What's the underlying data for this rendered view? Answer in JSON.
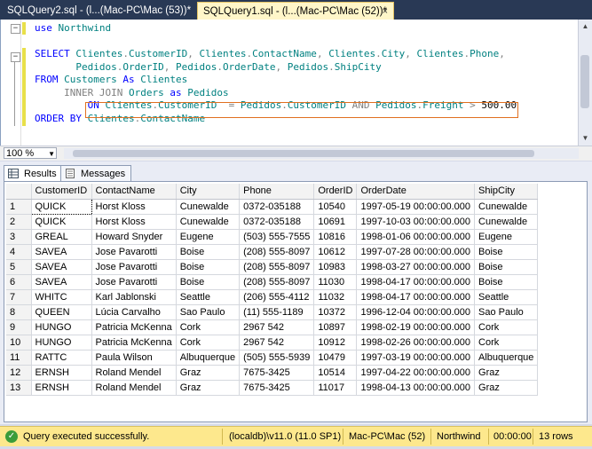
{
  "tabs": [
    {
      "label": "SQLQuery2.sql - (l...(Mac-PC\\Mac (53))*"
    },
    {
      "label": "SQLQuery1.sql - (l...(Mac-PC\\Mac (52))*",
      "close": "×"
    }
  ],
  "editor": {
    "lines": [
      [
        [
          "kw",
          "use"
        ],
        [
          "t",
          " "
        ],
        [
          "id",
          "Northwind"
        ]
      ],
      [
        [
          "t",
          ""
        ]
      ],
      [
        [
          "kw",
          "SELECT"
        ],
        [
          "t",
          " "
        ],
        [
          "id",
          "Clientes"
        ],
        [
          "gr",
          "."
        ],
        [
          "id",
          "CustomerID"
        ],
        [
          "gr",
          ", "
        ],
        [
          "id",
          "Clientes"
        ],
        [
          "gr",
          "."
        ],
        [
          "id",
          "ContactName"
        ],
        [
          "gr",
          ", "
        ],
        [
          "id",
          "Clientes"
        ],
        [
          "gr",
          "."
        ],
        [
          "id",
          "City"
        ],
        [
          "gr",
          ", "
        ],
        [
          "id",
          "Clientes"
        ],
        [
          "gr",
          "."
        ],
        [
          "id",
          "Phone"
        ],
        [
          "gr",
          ","
        ]
      ],
      [
        [
          "t",
          "       "
        ],
        [
          "id",
          "Pedidos"
        ],
        [
          "gr",
          "."
        ],
        [
          "id",
          "OrderID"
        ],
        [
          "gr",
          ", "
        ],
        [
          "id",
          "Pedidos"
        ],
        [
          "gr",
          "."
        ],
        [
          "id",
          "OrderDate"
        ],
        [
          "gr",
          ", "
        ],
        [
          "id",
          "Pedidos"
        ],
        [
          "gr",
          "."
        ],
        [
          "id",
          "ShipCity"
        ]
      ],
      [
        [
          "kw",
          "FROM"
        ],
        [
          "t",
          " "
        ],
        [
          "id",
          "Customers"
        ],
        [
          "t",
          " "
        ],
        [
          "kw",
          "As"
        ],
        [
          "t",
          " "
        ],
        [
          "id",
          "Clientes"
        ]
      ],
      [
        [
          "t",
          "     "
        ],
        [
          "gr",
          "INNER JOIN"
        ],
        [
          "t",
          " "
        ],
        [
          "id",
          "Orders"
        ],
        [
          "t",
          " "
        ],
        [
          "kw",
          "as"
        ],
        [
          "t",
          " "
        ],
        [
          "id",
          "Pedidos"
        ]
      ],
      [
        [
          "t",
          "         "
        ],
        [
          "kw",
          "ON"
        ],
        [
          "t",
          " "
        ],
        [
          "id",
          "Clientes"
        ],
        [
          "gr",
          "."
        ],
        [
          "id",
          "CustomerID"
        ],
        [
          "t",
          "  "
        ],
        [
          "gr",
          "="
        ],
        [
          "t",
          " "
        ],
        [
          "id",
          "Pedidos"
        ],
        [
          "gr",
          "."
        ],
        [
          "id",
          "CustomerID"
        ],
        [
          "t",
          " "
        ],
        [
          "gr",
          "AND"
        ],
        [
          "t",
          " "
        ],
        [
          "id",
          "Pedidos"
        ],
        [
          "gr",
          "."
        ],
        [
          "id",
          "Freight"
        ],
        [
          "t",
          " "
        ],
        [
          "gr",
          ">"
        ],
        [
          "t",
          " "
        ],
        [
          "t",
          "500.00"
        ]
      ],
      [
        [
          "kw",
          "ORDER BY"
        ],
        [
          "t",
          " "
        ],
        [
          "id",
          "Clientes"
        ],
        [
          "gr",
          "."
        ],
        [
          "id",
          "ContactName"
        ]
      ]
    ]
  },
  "zoom": {
    "value": "100 %"
  },
  "results_tabs": [
    {
      "label": "Results"
    },
    {
      "label": "Messages"
    }
  ],
  "grid": {
    "columns": [
      "CustomerID",
      "ContactName",
      "City",
      "Phone",
      "OrderID",
      "OrderDate",
      "ShipCity"
    ],
    "rows": [
      [
        "1",
        "QUICK",
        "Horst Kloss",
        "Cunewalde",
        "0372-035188",
        "10540",
        "1997-05-19 00:00:00.000",
        "Cunewalde"
      ],
      [
        "2",
        "QUICK",
        "Horst Kloss",
        "Cunewalde",
        "0372-035188",
        "10691",
        "1997-10-03 00:00:00.000",
        "Cunewalde"
      ],
      [
        "3",
        "GREAL",
        "Howard Snyder",
        "Eugene",
        "(503) 555-7555",
        "10816",
        "1998-01-06 00:00:00.000",
        "Eugene"
      ],
      [
        "4",
        "SAVEA",
        "Jose Pavarotti",
        "Boise",
        "(208) 555-8097",
        "10612",
        "1997-07-28 00:00:00.000",
        "Boise"
      ],
      [
        "5",
        "SAVEA",
        "Jose Pavarotti",
        "Boise",
        "(208) 555-8097",
        "10983",
        "1998-03-27 00:00:00.000",
        "Boise"
      ],
      [
        "6",
        "SAVEA",
        "Jose Pavarotti",
        "Boise",
        "(208) 555-8097",
        "11030",
        "1998-04-17 00:00:00.000",
        "Boise"
      ],
      [
        "7",
        "WHITC",
        "Karl Jablonski",
        "Seattle",
        "(206) 555-4112",
        "11032",
        "1998-04-17 00:00:00.000",
        "Seattle"
      ],
      [
        "8",
        "QUEEN",
        "Lúcia Carvalho",
        "Sao Paulo",
        "(11) 555-1189",
        "10372",
        "1996-12-04 00:00:00.000",
        "Sao Paulo"
      ],
      [
        "9",
        "HUNGO",
        "Patricia McKenna",
        "Cork",
        "2967 542",
        "10897",
        "1998-02-19 00:00:00.000",
        "Cork"
      ],
      [
        "10",
        "HUNGO",
        "Patricia McKenna",
        "Cork",
        "2967 542",
        "10912",
        "1998-02-26 00:00:00.000",
        "Cork"
      ],
      [
        "11",
        "RATTC",
        "Paula Wilson",
        "Albuquerque",
        "(505) 555-5939",
        "10479",
        "1997-03-19 00:00:00.000",
        "Albuquerque"
      ],
      [
        "12",
        "ERNSH",
        "Roland Mendel",
        "Graz",
        "7675-3425",
        "10514",
        "1997-04-22 00:00:00.000",
        "Graz"
      ],
      [
        "13",
        "ERNSH",
        "Roland Mendel",
        "Graz",
        "7675-3425",
        "11017",
        "1998-04-13 00:00:00.000",
        "Graz"
      ]
    ]
  },
  "status": {
    "message": "Query executed successfully.",
    "server": "(localdb)\\v11.0 (11.0 SP1)",
    "user": "Mac-PC\\Mac (52)",
    "database": "Northwind",
    "elapsed": "00:00:00",
    "rows": "13 rows"
  },
  "colors": {
    "status_bg": "#fde88d",
    "tab_active_bg": "#fff6c9",
    "keyword": "#0000ff",
    "identifier": "#008080"
  }
}
